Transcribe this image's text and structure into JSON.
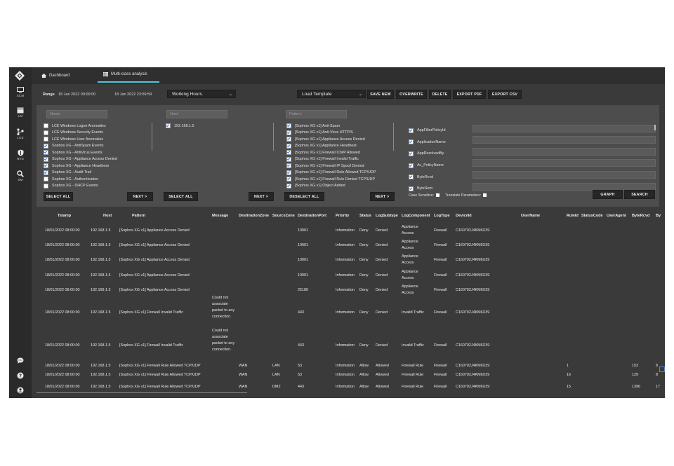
{
  "sidebar": {
    "items": [
      {
        "label": "SCM",
        "icon": "monitor-icon"
      },
      {
        "label": "LM",
        "icon": "inbox-icon"
      },
      {
        "label": "LCE",
        "icon": "graph-nodes-icon"
      },
      {
        "label": "NVS",
        "icon": "shield-icon"
      },
      {
        "label": "SM",
        "icon": "search-icon"
      }
    ],
    "bottom_icons": [
      "chat-icon",
      "help-icon",
      "user-icon"
    ]
  },
  "tabs": [
    {
      "label": "Dashboard",
      "icon": "home-icon"
    },
    {
      "label": "Multi-class analysis",
      "icon": "table-icon",
      "active": true
    }
  ],
  "toolbar": {
    "range_label": "Range",
    "range_start": "18 Jan 2022 00:00:00",
    "range_end": "18 Jan 2022 23:59:59",
    "period": "Working Hours",
    "template": "Load Template",
    "save_new": "SAVE NEW",
    "overwrite": "OVERWRITE",
    "delete": "DELETE",
    "export_pdf": "EXPORT PDF",
    "export_csv": "EXPORT CSV"
  },
  "filters": {
    "name_placeholder": "Name",
    "host_placeholder": "Host",
    "pattern_placeholder": "Pattern",
    "names": [
      {
        "label": "LCE Windows Logon Anomalies",
        "checked": false
      },
      {
        "label": "LCE Windows Security Events",
        "checked": false
      },
      {
        "label": "LCE Windows User Anomalies",
        "checked": false
      },
      {
        "label": "Sophos XG - AntiSpam Events",
        "checked": true
      },
      {
        "label": "Sophos XG - AntiVirus Events",
        "checked": true
      },
      {
        "label": "Sophos XG - Appliance Access Denied",
        "checked": true
      },
      {
        "label": "Sophos XG - Appliance Heartbeat",
        "checked": true
      },
      {
        "label": "Sophos XG - Audit Trail",
        "checked": true
      },
      {
        "label": "Sophos XG - Authentication",
        "checked": false
      },
      {
        "label": "Sophos XG - DHCP Events",
        "checked": false
      }
    ],
    "hosts": [
      {
        "label": "192.168.1.5",
        "checked": true
      }
    ],
    "patterns": [
      {
        "label": "[Sophos XG v1] Anti-Spam",
        "checked": true
      },
      {
        "label": "[Sophos XG v1] Anti-Virus HTTP/S",
        "checked": true
      },
      {
        "label": "[Sophos XG v1] Appliance Access Denied",
        "checked": true
      },
      {
        "label": "[Sophos XG v1] Appliance Heartbeat",
        "checked": true
      },
      {
        "label": "[Sophos XG v1] Firewall ICMP Allowed",
        "checked": true
      },
      {
        "label": "[Sophos XG v1] Firewall Invalid Traffic",
        "checked": true
      },
      {
        "label": "[Sophos XG v1] Firewall IP Spoof Denied",
        "checked": true
      },
      {
        "label": "[Sophos XG v1] Firewall Rule Allowed TCP/UDP",
        "checked": true
      },
      {
        "label": "[Sophos XG v1] Firewall Rule Denied TCP/UDP",
        "checked": true
      },
      {
        "label": "[Sophos XG v1] Object Added",
        "checked": true
      }
    ],
    "params": [
      {
        "label": "AppFilterPolicyId",
        "checked": true
      },
      {
        "label": "ApplicationName",
        "checked": true
      },
      {
        "label": "AppResolvedBy",
        "checked": true
      },
      {
        "label": "Av_PolicyName",
        "checked": true
      },
      {
        "label": "ByteRcvd",
        "checked": true
      },
      {
        "label": "ByteSent",
        "checked": true
      }
    ],
    "select_all": "SELECT ALL",
    "next": "NEXT >",
    "deselect_all": "DESELECT ALL",
    "case_sensitive": "Case Sensitive:",
    "translate_params": "Translate Parameters:",
    "graph": "GRAPH",
    "search": "SEARCH"
  },
  "table": {
    "columns": [
      "Tstamp",
      "Host",
      "Pattern",
      "Message",
      "DestinationZone",
      "SourceZone",
      "DestinationPort",
      "Priority",
      "Status",
      "LogSubtype",
      "LogComponent",
      "LogType",
      "DeviceId",
      "UserName",
      "RuleId",
      "StatusCode",
      "UserAgent",
      "ByteRcvd",
      "By"
    ],
    "rows": [
      {
        "tstamp": "18/01/2022 08:00:00",
        "host": "192.168.1.5",
        "pattern": "[Sophos XG v1] Appliance Access Denied",
        "message": "",
        "dzone": "",
        "szone": "",
        "dport": "10001",
        "priority": "Information",
        "status": "Deny",
        "subtype": "Denied",
        "component": "Appliance Access",
        "logtype": "Firewall",
        "device": "C160702J4KM6X39",
        "user": "",
        "rule": "",
        "code": "",
        "agent": "",
        "rcvd": "",
        "by": ""
      },
      {
        "tstamp": "18/01/2022 08:00:00",
        "host": "192.168.1.5",
        "pattern": "[Sophos XG v1] Appliance Access Denied",
        "message": "",
        "dzone": "",
        "szone": "",
        "dport": "10001",
        "priority": "Information",
        "status": "Deny",
        "subtype": "Denied",
        "component": "Appliance Access",
        "logtype": "Firewall",
        "device": "C160702J4KM6X39",
        "user": "",
        "rule": "",
        "code": "",
        "agent": "",
        "rcvd": "",
        "by": ""
      },
      {
        "tstamp": "18/01/2022 08:00:00",
        "host": "192.168.1.5",
        "pattern": "[Sophos XG v1] Appliance Access Denied",
        "message": "",
        "dzone": "",
        "szone": "",
        "dport": "10001",
        "priority": "Information",
        "status": "Deny",
        "subtype": "Denied",
        "component": "Appliance Access",
        "logtype": "Firewall",
        "device": "C160702J4KM6X39",
        "user": "",
        "rule": "",
        "code": "",
        "agent": "",
        "rcvd": "",
        "by": ""
      },
      {
        "tstamp": "18/01/2022 08:00:00",
        "host": "192.168.1.5",
        "pattern": "[Sophos XG v1] Appliance Access Denied",
        "message": "",
        "dzone": "",
        "szone": "",
        "dport": "10001",
        "priority": "Information",
        "status": "Deny",
        "subtype": "Denied",
        "component": "Appliance Access",
        "logtype": "Firewall",
        "device": "C160702J4KM6X39",
        "user": "",
        "rule": "",
        "code": "",
        "agent": "",
        "rcvd": "",
        "by": ""
      },
      {
        "tstamp": "18/01/2022 08:00:00",
        "host": "192.168.1.5",
        "pattern": "[Sophos XG v1] Appliance Access Denied",
        "message": "",
        "dzone": "",
        "szone": "",
        "dport": "25186",
        "priority": "Information",
        "status": "Deny",
        "subtype": "Denied",
        "component": "Appliance Access",
        "logtype": "Firewall",
        "device": "C160702J4KM6X39",
        "user": "",
        "rule": "",
        "code": "",
        "agent": "",
        "rcvd": "",
        "by": ""
      },
      {
        "tstamp": "18/01/2022 08:00:00",
        "host": "192.168.1.5",
        "pattern": "[Sophos XG v1] Firewall Invalid Traffic",
        "message": "Could not associate packet to any connection.",
        "dzone": "",
        "szone": "",
        "dport": "443",
        "priority": "Information",
        "status": "Deny",
        "subtype": "Denied",
        "component": "Invalid Traffic",
        "logtype": "Firewall",
        "device": "C160702J4KM6X39",
        "user": "",
        "rule": "",
        "code": "",
        "agent": "",
        "rcvd": "",
        "by": ""
      },
      {
        "tstamp": "18/01/2022 08:00:00",
        "host": "192.168.1.5",
        "pattern": "[Sophos XG v1] Firewall Invalid Traffic",
        "message": "Could not associate packet to any connection.",
        "dzone": "",
        "szone": "",
        "dport": "443",
        "priority": "Information",
        "status": "Deny",
        "subtype": "Denied",
        "component": "Invalid Traffic",
        "logtype": "Firewall",
        "device": "C160702J4KM6X39",
        "user": "",
        "rule": "",
        "code": "",
        "agent": "",
        "rcvd": "",
        "by": ""
      },
      {
        "tstamp": "18/01/2022 08:00:00",
        "host": "192.168.1.5",
        "pattern": "[Sophos XG v1] Firewall Rule Allowed TCP/UDP",
        "message": "",
        "dzone": "WAN",
        "szone": "LAN",
        "dport": "53",
        "priority": "Information",
        "status": "Allow",
        "subtype": "Allowed",
        "component": "Firewall Rule",
        "logtype": "Firewall",
        "device": "C160702J4KM6X39",
        "user": "",
        "rule": "1",
        "code": "",
        "agent": "",
        "rcvd": "153",
        "by": "8"
      },
      {
        "tstamp": "18/01/2022 08:00:00",
        "host": "192.168.1.5",
        "pattern": "[Sophos XG v1] Firewall Rule Allowed TCP/UDP",
        "message": "",
        "dzone": "WAN",
        "szone": "LAN",
        "dport": "53",
        "priority": "Information",
        "status": "Allow",
        "subtype": "Allowed",
        "component": "Firewall Rule",
        "logtype": "Firewall",
        "device": "C160702J4KM6X39",
        "user": "",
        "rule": "16",
        "code": "",
        "agent": "",
        "rcvd": "129",
        "by": "8"
      },
      {
        "tstamp": "18/01/2022 08:00:00",
        "host": "192.168.1.5",
        "pattern": "[Sophos XG v1] Firewall Rule Allowed TCP/UDP",
        "message": "",
        "dzone": "WAN",
        "szone": "DMZ",
        "dport": "443",
        "priority": "Information",
        "status": "Allow",
        "subtype": "Allowed",
        "component": "Firewall Rule",
        "logtype": "Firewall",
        "device": "C160702J4KM6X39",
        "user": "",
        "rule": "15",
        "code": "",
        "agent": "",
        "rcvd": "1396",
        "by": "17"
      }
    ]
  }
}
